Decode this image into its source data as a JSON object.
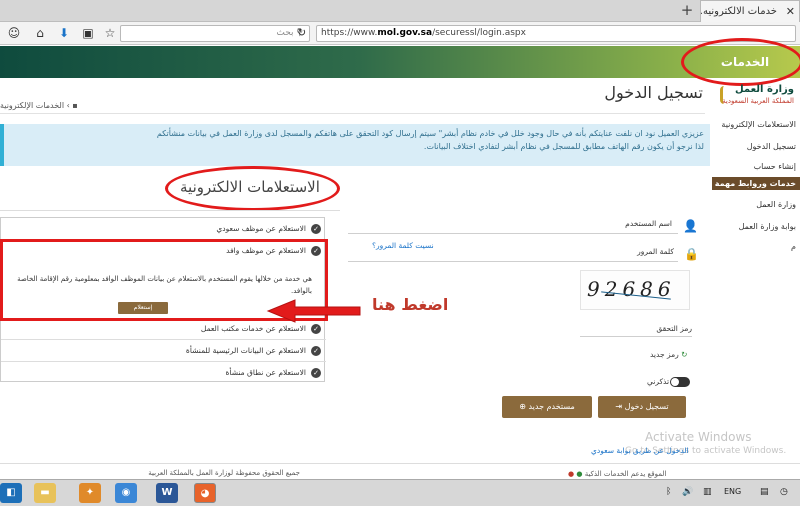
{
  "browser": {
    "tab_title": "خدمات الالكترونيه...",
    "tab_close": "✕",
    "new_tab": "+",
    "search_placeholder": "بحث",
    "url_prefix": "https://www.",
    "url_domain": "mol.gov.sa",
    "url_path": "/securessl/login.aspx"
  },
  "header": {
    "brand": "الخدمات الإلكترونية"
  },
  "logo": {
    "title": "وزارة العمل",
    "subtitle": "المملكة العربية السعودية"
  },
  "page": {
    "title": "تسجيل الدخول",
    "breadcrumb": "الخدمات الإلكترونية ‹"
  },
  "notice": {
    "line1": "عزيزي العميل نود ان نلفت عنايتكم بأنه في حال وجود خلل في خادم نظام أبشر\" سيتم إرسال كود التحقق على هاتفكم والمسجل لدى وزارة العمل في بيانات منشأتكم",
    "line2": "لذا نرجو أن يكون رقم الهاتف مطابق للمسجل في نظام أبشر لتفادي اختلاف البيانات."
  },
  "sidebar": {
    "items": [
      "الاستعلامات الإلكترونية",
      "تسجيل الدخول",
      "إنشاء حساب"
    ],
    "section_title": "خدمات وروابط مهمة",
    "links": [
      "وزارة العمل",
      "بوابة وزارة العمل",
      "م"
    ]
  },
  "inquiries": {
    "title": "الاستعلامات الالكترونية",
    "items": [
      "الاستعلام عن موظف سعودي",
      "الاستعلام عن موظف وافد",
      "الاستعلام عن خدمات مكتب العمل",
      "الاستعلام عن البيانات الرئيسية للمنشأة",
      "الاستعلام عن نطاق منشأة"
    ],
    "expanded_desc": "هي خدمة من خلالها يقوم المستخدم بالاستعلام عن بيانات الموظف الوافد بمعلومية رقم الإقامة الخاصة بالوافد.",
    "query_button": "إستعلام",
    "annotation": "اضغط هنا"
  },
  "form": {
    "username_label": "اسم المستخدم",
    "password_label": "كلمة المرور",
    "forgot_password": "نسيت كلمة المرور؟",
    "captcha_text": "92686",
    "captcha_label": "رمز التحقق",
    "new_code": "رمز جديد",
    "remember_me": "تذكرني",
    "login_button": "تسجيل دخول",
    "register_button": "مستخدم جديد",
    "abshir_link": "الدخول عن طريق بوابة سعودي"
  },
  "watermark": {
    "line1": "Activate Windows",
    "line2": "Go to Settings to activate Windows."
  },
  "footer": {
    "copyright": "جميع الحقوق محفوظة لوزارة العمل بالمملكة العربية",
    "right_text": "الموقع يدعم الخدمات الذكية"
  },
  "taskbar": {
    "word_label": "W",
    "lang": "ENG"
  },
  "colors": {
    "header_green": "#0f4b3e",
    "accent_brown": "#8b6a3c",
    "annotation_red": "#e21b1b",
    "notice_bg": "#d9edf7"
  }
}
